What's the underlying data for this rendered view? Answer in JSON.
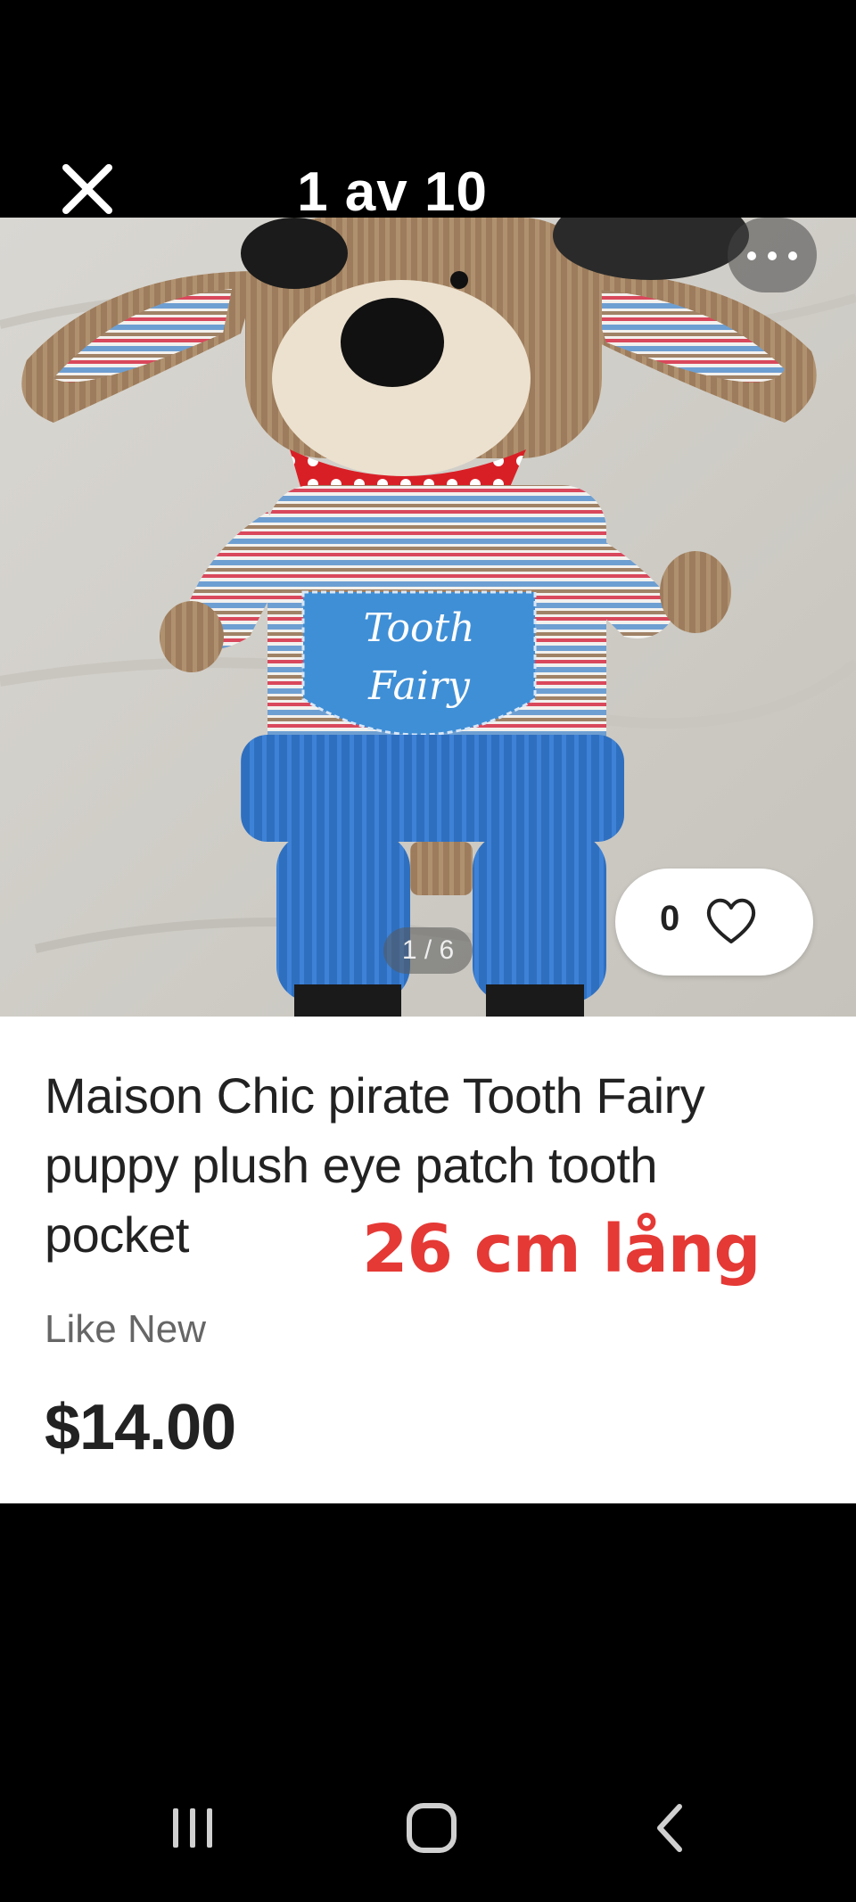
{
  "viewer": {
    "counter": "1 av 10"
  },
  "photo": {
    "pocket_text_line1": "Tooth",
    "pocket_text_line2": "Fairy",
    "page_indicator": "1 / 6",
    "like_count": "0"
  },
  "product": {
    "title": "Maison Chic pirate Tooth Fairy puppy plush eye patch tooth pocket",
    "overlay_size": "26 cm lång",
    "condition": "Like New",
    "price": "$14.00"
  },
  "colors": {
    "accent_red": "#e53935",
    "text_dark": "#222222",
    "text_muted": "#666666",
    "background_dark": "#000000"
  },
  "icons": {
    "close": "close-icon",
    "more": "more-icon",
    "like": "heart-icon",
    "recents": "recents-icon",
    "home": "home-icon",
    "back": "back-icon"
  }
}
